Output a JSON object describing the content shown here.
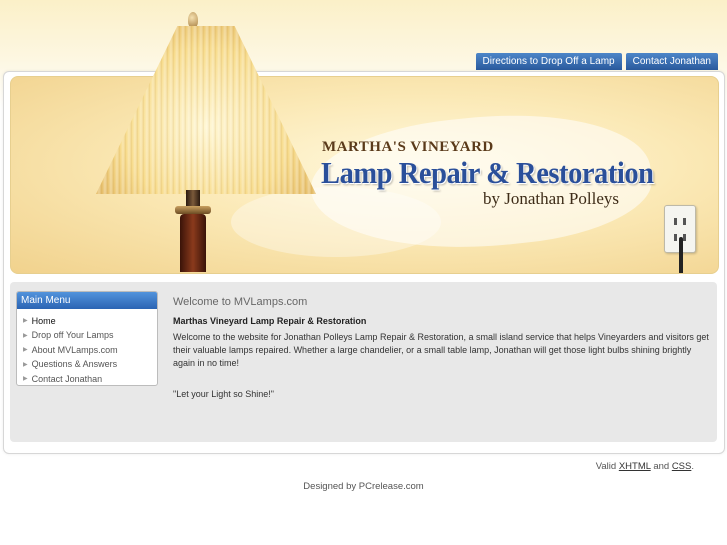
{
  "topnav": {
    "items": [
      "Directions to Drop Off a Lamp",
      "Contact Jonathan"
    ]
  },
  "banner": {
    "line1": "MARTHA'S VINEYARD",
    "line2": "Lamp Repair & Restoration",
    "line3": "by Jonathan Polleys"
  },
  "menu": {
    "title": "Main Menu",
    "items": [
      "Home",
      "Drop off Your Lamps",
      "About MVLamps.com",
      "Questions & Answers",
      "Contact Jonathan"
    ],
    "active": "Home"
  },
  "content": {
    "heading": "Welcome to MVLamps.com",
    "subheading": "Marthas Vineyard Lamp Repair & Restoration",
    "body": "Welcome to the website for Jonathan Polleys Lamp Repair & Restoration, a small island service that helps Vineyarders and visitors get their valuable lamps repaired. Whether a large chandelier, or a small table lamp, Jonathan will get those light bulbs shining brightly again in no time!",
    "quote": "\"Let your Light so Shine!\""
  },
  "footer": {
    "valid_prefix": "Valid",
    "xhtml": "XHTML",
    "and": "and",
    "css": "CSS",
    "designed": "Designed by PCrelease.com"
  },
  "colors": {
    "nav_blue": "#2a5a9d",
    "title_blue": "#2a4f9a",
    "panel_gray": "#e8e8e8"
  }
}
